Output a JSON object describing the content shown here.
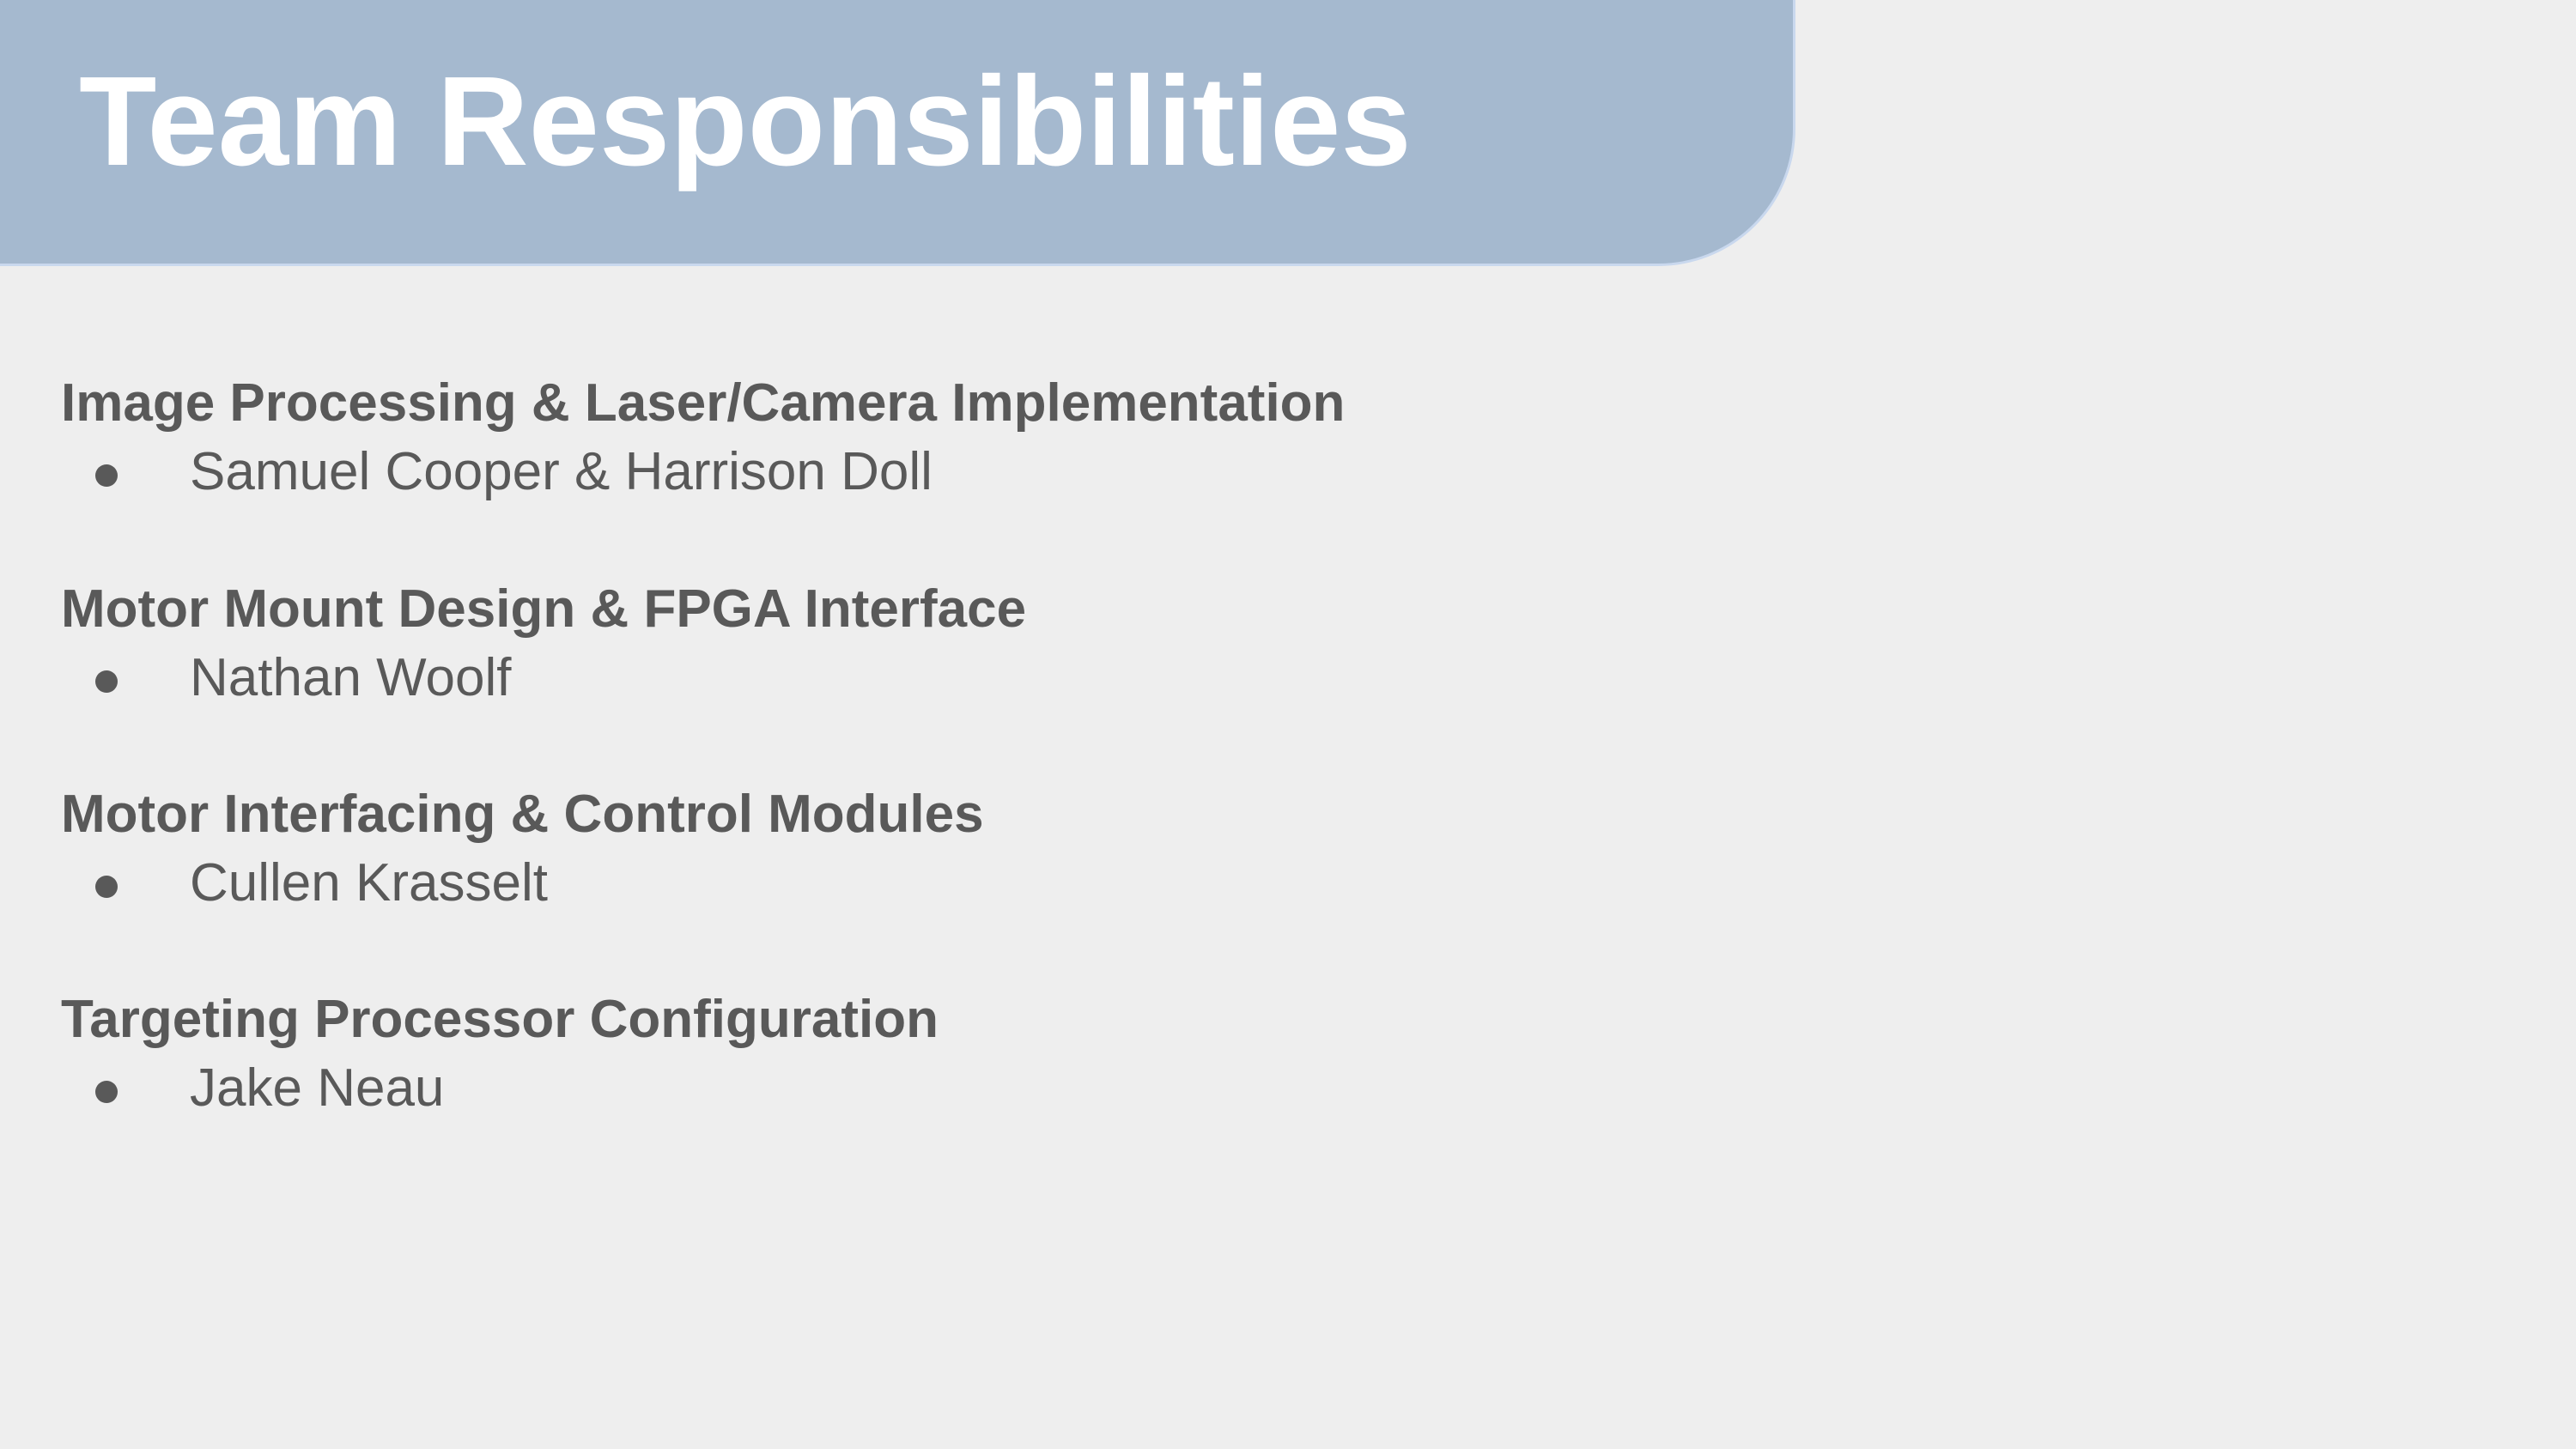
{
  "slide": {
    "title": "Team Responsibilities",
    "colors": {
      "header": "#a5b9cf",
      "text": "#595959",
      "background": "#eeeeee"
    },
    "sections": [
      {
        "heading": "Image Processing & Laser/Camera Implementation",
        "members": "Samuel Cooper & Harrison Doll"
      },
      {
        "heading": "Motor Mount Design & FPGA Interface",
        "members": "Nathan Woolf"
      },
      {
        "heading": "Motor Interfacing & Control Modules",
        "members": "Cullen Krasselt"
      },
      {
        "heading": "Targeting Processor Configuration",
        "members": "Jake Neau"
      }
    ]
  }
}
